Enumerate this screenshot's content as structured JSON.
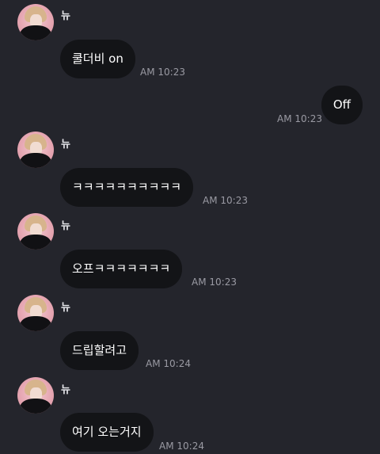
{
  "chat": {
    "sender_name": "뉴",
    "messages": [
      {
        "direction": "incoming",
        "text": "쿨더비 on",
        "time": "AM 10:23"
      },
      {
        "direction": "outgoing",
        "text": "Off",
        "time": "AM 10:23"
      },
      {
        "direction": "incoming",
        "text": "ㅋㅋㅋㅋㅋㅋㅋㅋㅋㅋ",
        "time": "AM 10:23"
      },
      {
        "direction": "incoming",
        "text": "오프ㅋㅋㅋㅋㅋㅋㅋ",
        "time": "AM 10:23"
      },
      {
        "direction": "incoming",
        "text": "드립할려고",
        "time": "AM 10:24"
      },
      {
        "direction": "incoming",
        "text": "여기 오는거지",
        "time": "AM 10:24"
      }
    ]
  },
  "colors": {
    "background": "#24252c",
    "bubble": "#131417",
    "avatar_accent": "#e6a7b3"
  }
}
